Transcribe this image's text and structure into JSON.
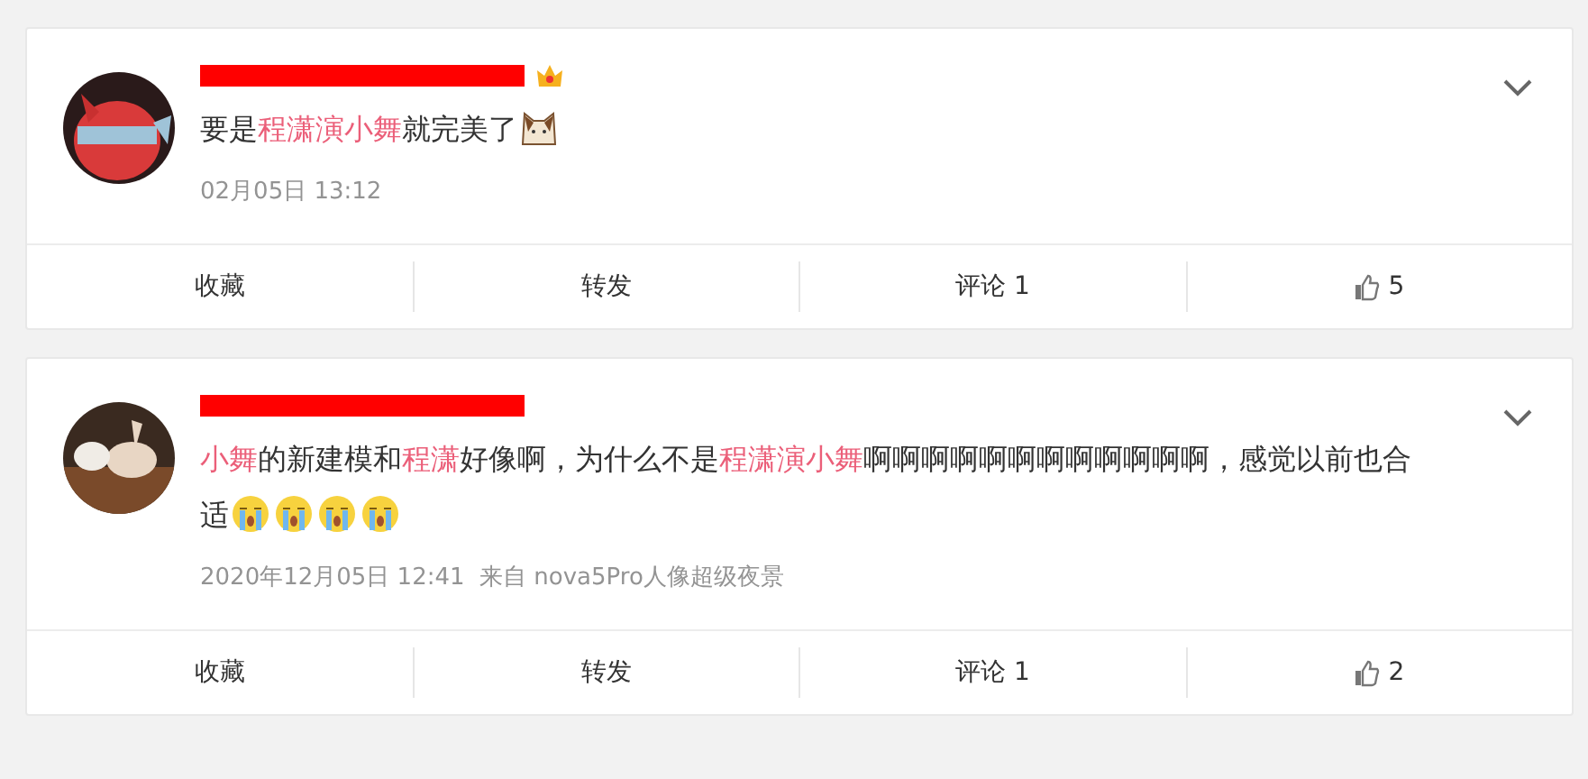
{
  "comments": [
    {
      "user": {
        "name_redacted": true,
        "badges": [
          {
            "kind": "crown"
          }
        ]
      },
      "content": [
        {
          "kind": "plain",
          "text": "要是"
        },
        {
          "kind": "link",
          "text": "程潇演小舞"
        },
        {
          "kind": "plain",
          "text": "就完美了"
        },
        {
          "kind": "cat"
        }
      ],
      "time": "02月05日 13:12",
      "footer": [
        {
          "kind": "plain",
          "label": "收藏"
        },
        {
          "kind": "plain",
          "label": "转发"
        },
        {
          "kind": "plain",
          "label": "评论 1"
        },
        {
          "kind": "like",
          "label": "5"
        }
      ]
    },
    {
      "user": {
        "name_redacted": true
      },
      "content": [
        {
          "kind": "link",
          "text": "小舞"
        },
        {
          "kind": "plain",
          "text": "的新建模和"
        },
        {
          "kind": "link",
          "text": "程潇"
        },
        {
          "kind": "plain",
          "text": "好像啊，为什么不是"
        },
        {
          "kind": "link",
          "text": "程潇演小舞"
        },
        {
          "kind": "plain",
          "text": "啊啊啊啊啊啊啊啊啊啊啊啊，感觉以前也合适"
        },
        {
          "kind": "crying"
        },
        {
          "kind": "crying"
        },
        {
          "kind": "crying"
        },
        {
          "kind": "crying"
        }
      ],
      "time": "2020年12月05日 12:41  来自 nova5Pro人像超级夜景",
      "footer": [
        {
          "kind": "plain",
          "label": "收藏"
        },
        {
          "kind": "plain",
          "label": "转发"
        },
        {
          "kind": "plain",
          "label": "评论 1"
        },
        {
          "kind": "like",
          "label": "2"
        }
      ]
    }
  ]
}
